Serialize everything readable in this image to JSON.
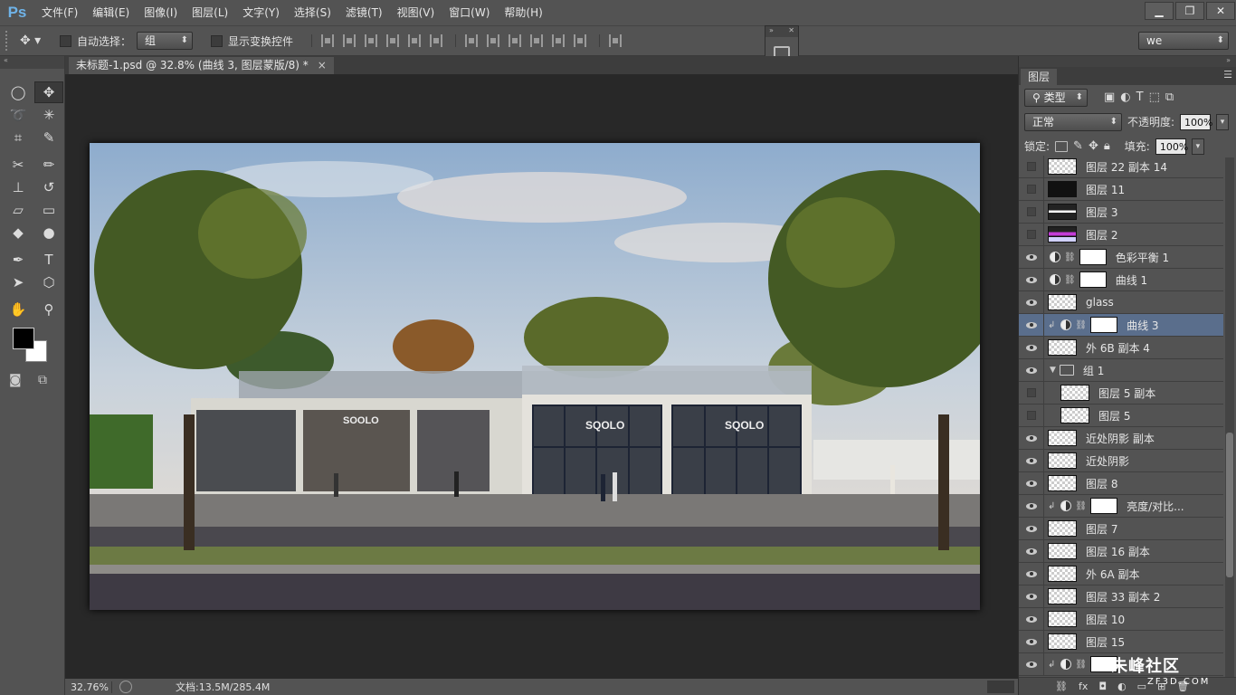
{
  "app": {
    "logo": "Ps"
  },
  "menu": [
    "文件(F)",
    "编辑(E)",
    "图像(I)",
    "图层(L)",
    "文字(Y)",
    "选择(S)",
    "滤镜(T)",
    "视图(V)",
    "窗口(W)",
    "帮助(H)"
  ],
  "window_controls": [
    "minimize-icon",
    "restore-icon",
    "close-icon"
  ],
  "options": {
    "auto_select_label": "自动选择：",
    "auto_select_value": "组",
    "show_transform_label": "显示变换控件",
    "workspace": "we"
  },
  "document": {
    "tab_title": "未标题-1.psd @ 32.8% (曲线 3, 图层蒙版/8) *",
    "close": "×"
  },
  "status": {
    "zoom": "32.76%",
    "doc_size": "文档:13.5M/285.4M"
  },
  "layers_panel": {
    "tab": "图层",
    "filter_label": "类型",
    "blend_mode": "正常",
    "opacity_label": "不透明度:",
    "opacity_value": "100%",
    "lock_label": "锁定:",
    "fill_label": "填充:",
    "fill_value": "100%",
    "layers": [
      {
        "name": "图层 22 副本 14",
        "visible": false,
        "thumb": "trans"
      },
      {
        "name": "图层 11",
        "visible": false,
        "thumb": "dark"
      },
      {
        "name": "图层 3",
        "visible": false,
        "thumb": "dark-strip"
      },
      {
        "name": "图层 2",
        "visible": false,
        "thumb": "magenta"
      },
      {
        "name": "色彩平衡 1",
        "visible": true,
        "type": "adjust"
      },
      {
        "name": "曲线 1",
        "visible": true,
        "type": "adjust"
      },
      {
        "name": "glass",
        "visible": true,
        "thumb": "trans"
      },
      {
        "name": "曲线 3",
        "visible": true,
        "type": "adjust-clip",
        "active": true
      },
      {
        "name": "外 6B 副本 4",
        "visible": true,
        "thumb": "trans"
      },
      {
        "name": "组 1",
        "visible": true,
        "type": "group"
      },
      {
        "name": "图层 5 副本",
        "visible": false,
        "thumb": "trans",
        "indent": true
      },
      {
        "name": "图层 5",
        "visible": false,
        "thumb": "trans",
        "indent": true
      },
      {
        "name": "近处阴影 副本",
        "visible": true,
        "thumb": "trans"
      },
      {
        "name": "近处阴影",
        "visible": true,
        "thumb": "trans"
      },
      {
        "name": "图层 8",
        "visible": true,
        "thumb": "trans"
      },
      {
        "name": "亮度/对比...",
        "visible": true,
        "type": "adjust-clip"
      },
      {
        "name": "图层 7",
        "visible": true,
        "thumb": "trans"
      },
      {
        "name": "图层 16 副本",
        "visible": true,
        "thumb": "trans"
      },
      {
        "name": "外 6A 副本",
        "visible": true,
        "thumb": "trans"
      },
      {
        "name": "图层 33 副本 2",
        "visible": true,
        "thumb": "trans"
      },
      {
        "name": "图层 10",
        "visible": true,
        "thumb": "trans"
      },
      {
        "name": "图层 15",
        "visible": true,
        "thumb": "trans"
      },
      {
        "name": "",
        "visible": true,
        "type": "adjust-clip"
      }
    ]
  },
  "canvas_image": {
    "signs": [
      "SOOLO",
      "SQOLO",
      "SQOLO"
    ]
  },
  "watermark": {
    "text": "朱峰社区",
    "sub": "ZF3D.COM"
  }
}
